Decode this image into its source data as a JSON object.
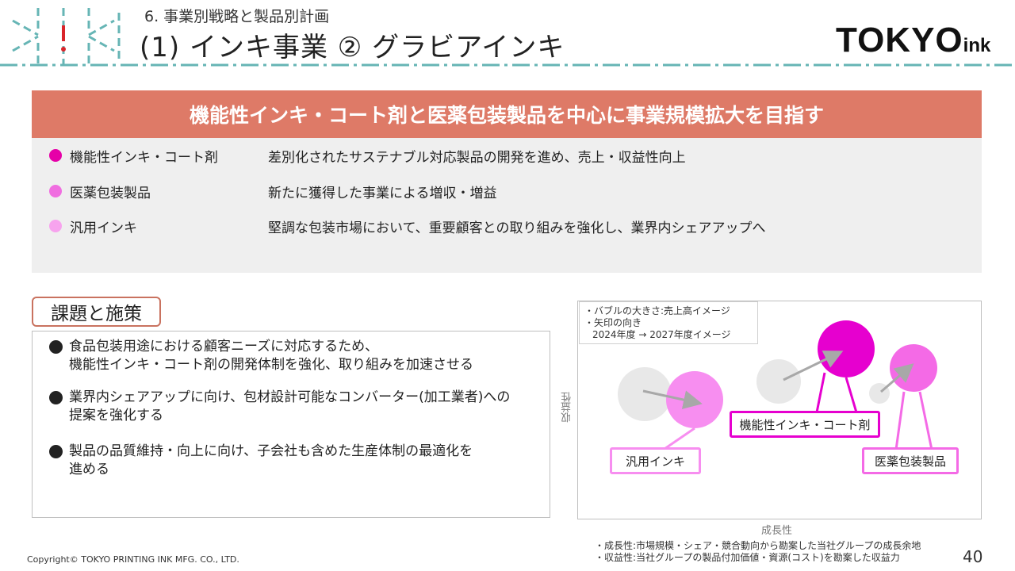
{
  "header": {
    "subtitle": "6. 事業別戦略と製品別計画",
    "title": "(1) インキ事業 ② グラビアインキ",
    "brand_main": "TOKYO",
    "brand_small": "ink"
  },
  "banner": "機能性インキ・コート剤と医薬包装製品を中心に事業規模拡大を目指す",
  "items": [
    {
      "label": "機能性インキ・コート剤",
      "desc": "差別化されたサステナブル対応製品の開発を進め、売上・収益性向上",
      "color": "#e600a8"
    },
    {
      "label": "医薬包装製品",
      "desc": "新たに獲得した事業による増収・増益",
      "color": "#f06ee0"
    },
    {
      "label": "汎用インキ",
      "desc": "堅調な包装市場において、重要顧客との取り組みを強化し、業界内シェアアップへ",
      "color": "#f7a3ee"
    }
  ],
  "issues": {
    "title": "課題と施策",
    "bullets": [
      {
        "line1": "食品包装用途における顧客ニーズに対応するため、",
        "line2": "機能性インキ・コート剤の開発体制を強化、取り組みを加速させる"
      },
      {
        "line1": "業界内シェアアップに向け、包材設計可能なコンバーター(加工業者)への",
        "line2": "提案を強化する"
      },
      {
        "line1": "製品の品質維持・向上に向け、子会社も含めた生産体制の最適化を",
        "line2": "進める"
      }
    ]
  },
  "chart": {
    "legend_line1": "・バブルの大きさ:売上高イメージ",
    "legend_line2": "・矢印の向き",
    "legend_line3": "2024年度 → 2027年度イメージ",
    "y_axis": "収益性",
    "x_axis": "成長性",
    "label_functional": "機能性インキ・コート剤",
    "label_general": "汎用インキ",
    "label_medical": "医薬包装製品",
    "colors": {
      "functional": "#e600cf",
      "medical": "#f46ae6",
      "general": "#f78ef0",
      "before": "#e8e8e8",
      "arrow": "#a8a8a8"
    }
  },
  "chart_data": {
    "type": "scatter",
    "xlabel": "成長性",
    "ylabel": "収益性",
    "note": "2024年度 → 2027年度イメージ",
    "series": [
      {
        "name": "汎用インキ",
        "from": "2024年度",
        "to": "2027年度"
      },
      {
        "name": "機能性インキ・コート剤",
        "from": "2024年度",
        "to": "2027年度"
      },
      {
        "name": "医薬包装製品",
        "from": "2024年度",
        "to": "2027年度"
      }
    ]
  },
  "notes": {
    "line1": "・成長性:市場規模・シェア・競合動向から勘案した当社グループの成長余地",
    "line2": "・収益性:当社グループの製品付加価値・資源(コスト)を勘案した収益力"
  },
  "footer": {
    "copyright": "Copyright© TOKYO PRINTING INK MFG. CO., LTD.",
    "page": "40"
  }
}
